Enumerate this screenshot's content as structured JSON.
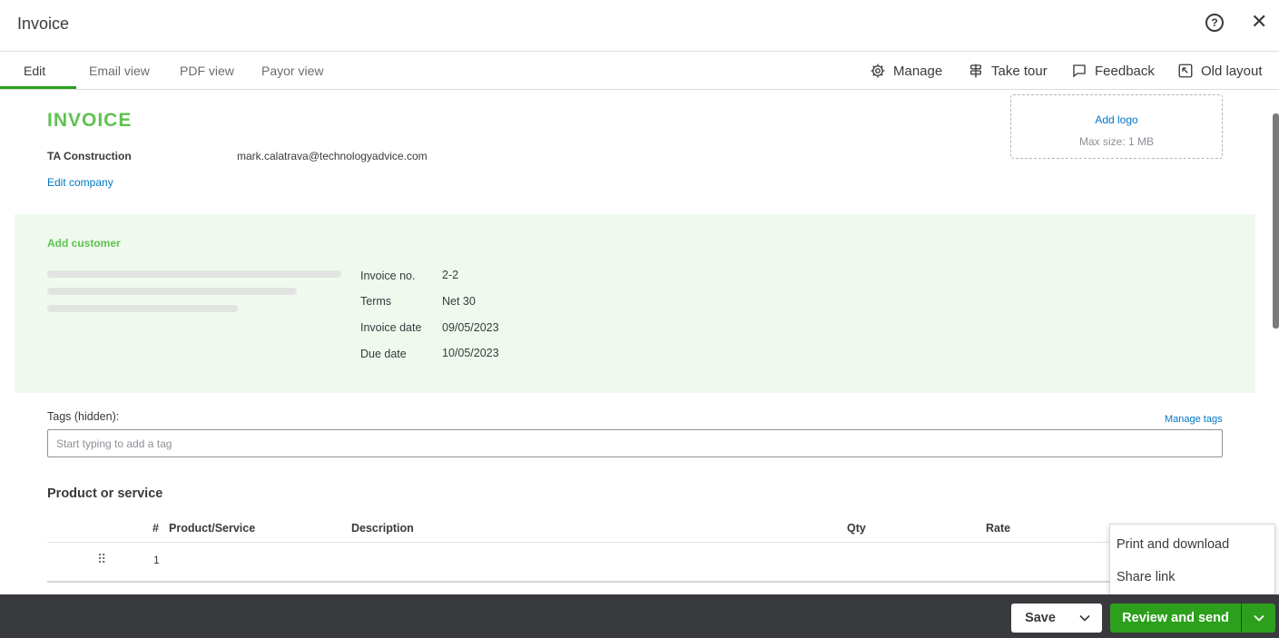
{
  "window": {
    "title": "Invoice"
  },
  "tabs": [
    {
      "label": "Edit",
      "active": true
    },
    {
      "label": "Email view"
    },
    {
      "label": "PDF view"
    },
    {
      "label": "Payor view"
    }
  ],
  "tools": {
    "manage": "Manage",
    "tour": "Take tour",
    "feedback": "Feedback",
    "old_layout": "Old layout"
  },
  "invoice": {
    "heading": "INVOICE",
    "company_name": "TA Construction",
    "company_email": "mark.calatrava@technologyadvice.com",
    "edit_company": "Edit company",
    "logo": {
      "add": "Add logo",
      "max_size": "Max size: 1 MB"
    }
  },
  "customer": {
    "add_label": "Add customer",
    "meta": [
      {
        "label": "Invoice no.",
        "value": "2-2"
      },
      {
        "label": "Terms",
        "value": "Net 30"
      },
      {
        "label": "Invoice date",
        "value": "09/05/2023"
      },
      {
        "label": "Due date",
        "value": "10/05/2023"
      }
    ]
  },
  "tags": {
    "label": "Tags (hidden):",
    "manage": "Manage tags",
    "placeholder": "Start typing to add a tag"
  },
  "products": {
    "title": "Product or service",
    "columns": [
      "#",
      "Product/Service",
      "Description",
      "Qty",
      "Rate"
    ],
    "rows": [
      {
        "num": "1"
      }
    ]
  },
  "dropdown": {
    "items": [
      "Print and download",
      "Share link"
    ]
  },
  "footer": {
    "save": "Save",
    "send": "Review and send"
  },
  "colors": {
    "brand_green": "#2ca01c",
    "invoice_green": "#5ec24f",
    "link_blue": "#0077c5",
    "footer_bg": "#393a3d"
  }
}
